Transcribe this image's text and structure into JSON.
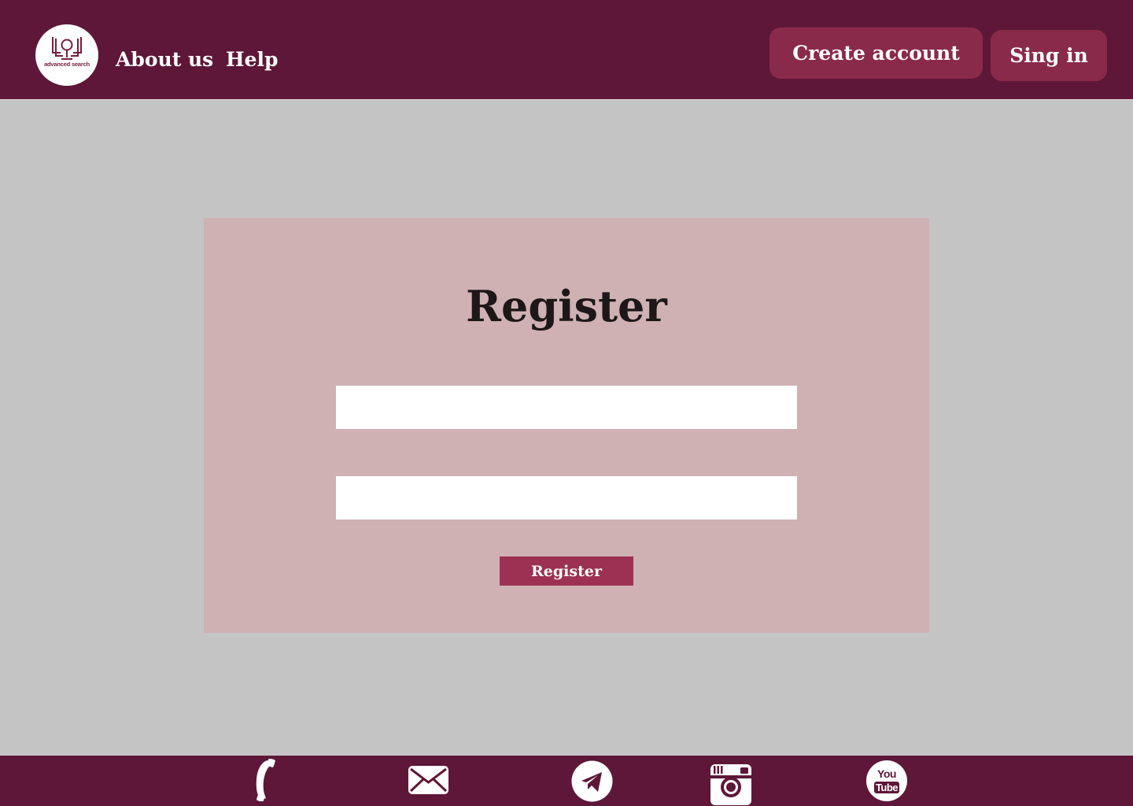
{
  "header": {
    "logo_text": "advanced search",
    "nav": {
      "about_label": "About us",
      "help_label": "Help"
    },
    "create_account_label": "Create account",
    "sign_in_label": "Sing in"
  },
  "form": {
    "title": "Register",
    "field1_value": "",
    "field2_value": "",
    "submit_label": "Register"
  },
  "footer": {
    "icons": [
      "phone-icon",
      "mail-icon",
      "telegram-icon",
      "instagram-icon",
      "youtube-icon"
    ],
    "youtube_you": "You",
    "youtube_tube": "Tube"
  },
  "colors": {
    "header_bg": "#5e1738",
    "header_button_bg": "#8a2a4b",
    "page_bg": "#c4c4c4",
    "card_bg": "#cfb1b3",
    "submit_bg": "#9c3153"
  }
}
